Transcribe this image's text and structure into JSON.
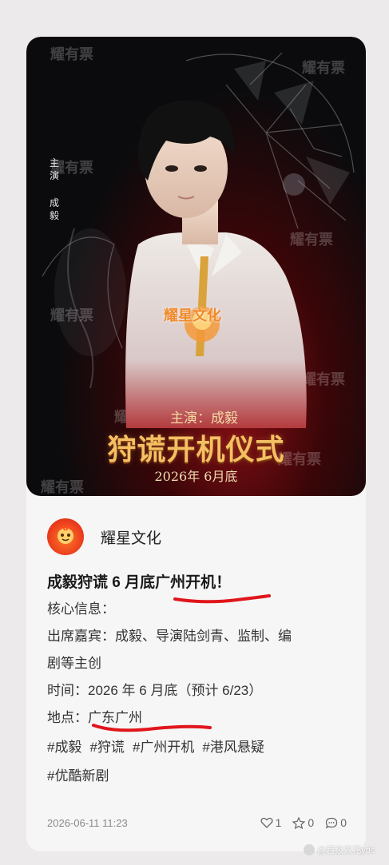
{
  "poster": {
    "watermark": "耀有票",
    "vertical_credit": [
      "主",
      "演",
      "成",
      "毅"
    ],
    "brand_badge": "耀星文化",
    "subtitle": "主演：成毅",
    "title": "狩谎开机仪式",
    "date": "2026年 6月底"
  },
  "account": {
    "name": "耀星文化"
  },
  "post": {
    "title": "成毅狩谎 6 月底广州开机！",
    "lines": [
      "核心信息：",
      "出席嘉宾：成毅、导演陆剑青、监制、编",
      "剧等主创",
      "时间：2026 年 6 月底（预计 6/23）",
      "地点：广东广州"
    ],
    "tags": [
      "#成毅",
      "#狩谎",
      "#广州开机",
      "#港风悬疑",
      "#优酷新剧"
    ]
  },
  "footer": {
    "timestamp": "2026-06-11 11:23",
    "likes": "1",
    "favorites": "0",
    "comments": "0"
  },
  "credit_watermark": "@超级双花yds",
  "colors": {
    "card_bg": "#f7f6f6",
    "poster_title": "#f5c063",
    "underline_red": "#e0161c",
    "avatar_orange": "#ea3b1c"
  }
}
